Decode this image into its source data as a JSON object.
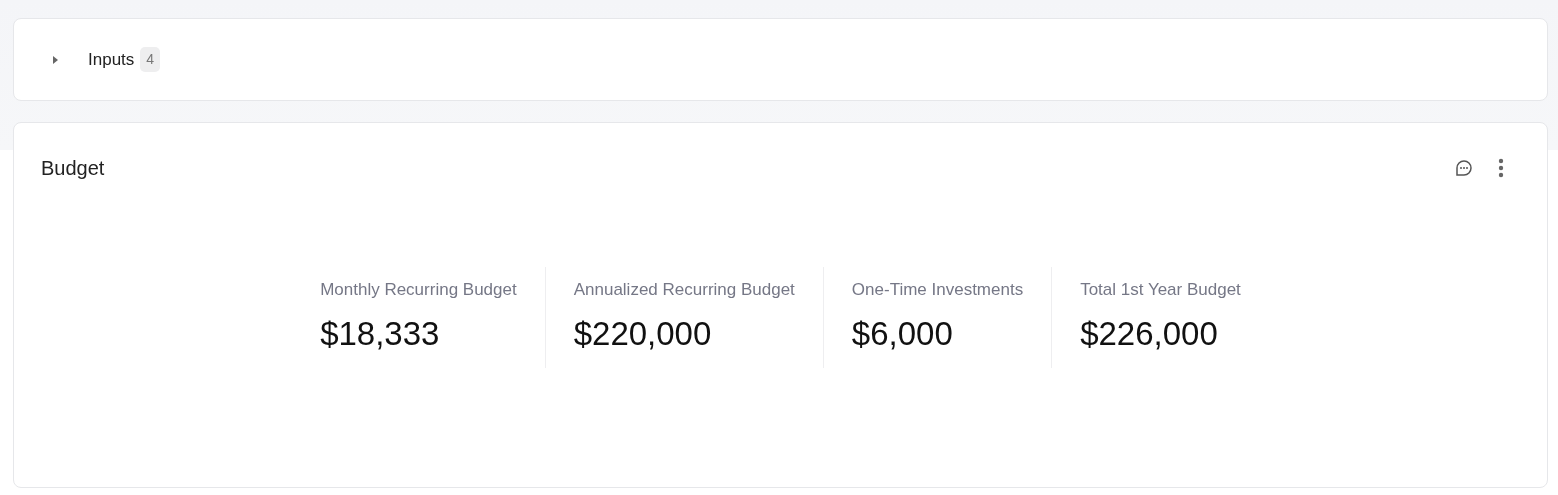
{
  "inputs_section": {
    "label": "Inputs",
    "count": "4",
    "expanded": false
  },
  "budget_card": {
    "title": "Budget",
    "metrics": [
      {
        "label": "Monthly Recurring Budget",
        "value": "$18,333"
      },
      {
        "label": "Annualized Recurring Budget",
        "value": "$220,000"
      },
      {
        "label": "One-Time Investments",
        "value": "$6,000"
      },
      {
        "label": "Total 1st Year Budget",
        "value": "$226,000"
      }
    ]
  }
}
